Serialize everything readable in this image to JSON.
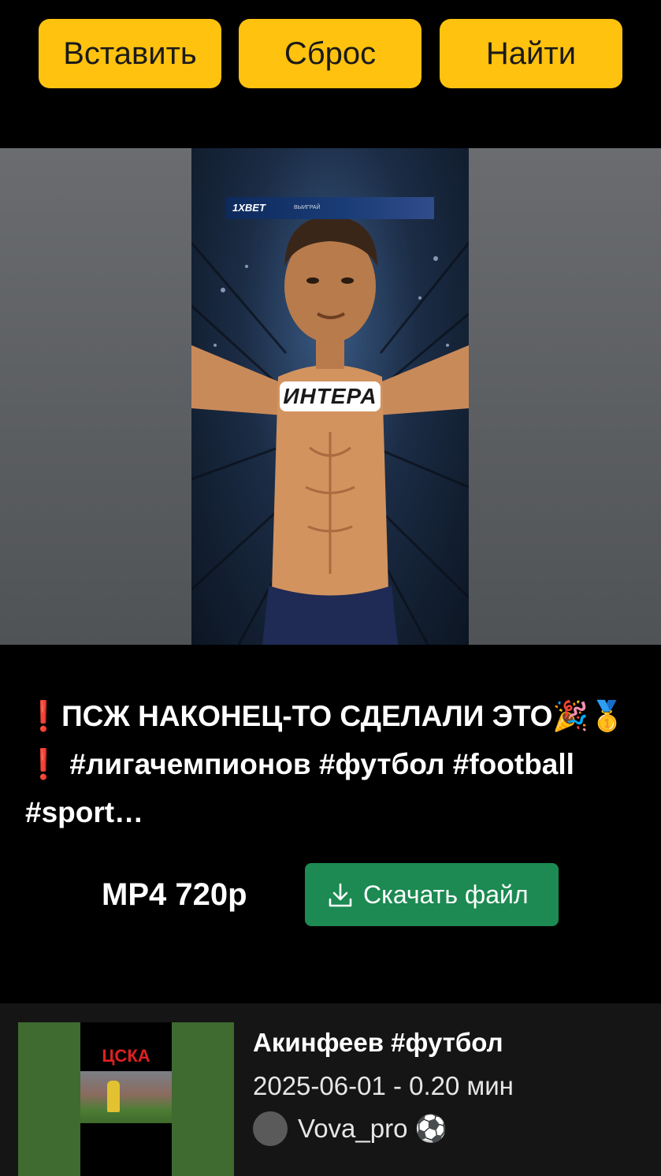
{
  "toolbar": {
    "paste_label": "Вставить",
    "reset_label": "Сброс",
    "find_label": "Найти",
    "button_color": "#ffc20e"
  },
  "video": {
    "brand_logo": "1XBET",
    "brand_sub": "ВЫИГРАЙ",
    "overlay_text": "ИНТЕРА",
    "title": "❗ПСЖ НАКОНЕЦ-ТО СДЕЛАЛИ ЭТО🎉🥇❗ #лигачемпионов #футбол #football #sport…"
  },
  "download": {
    "format_label": "MP4 720p",
    "button_label": "Скачать файл",
    "button_icon": "download-icon",
    "button_color": "#1c8a52"
  },
  "related": {
    "thumb_label": "ЦСКА",
    "title": "Акинфеев #футбол",
    "meta": "2025-06-01 - 0.20 мин",
    "author": "Vova_pro ⚽"
  }
}
